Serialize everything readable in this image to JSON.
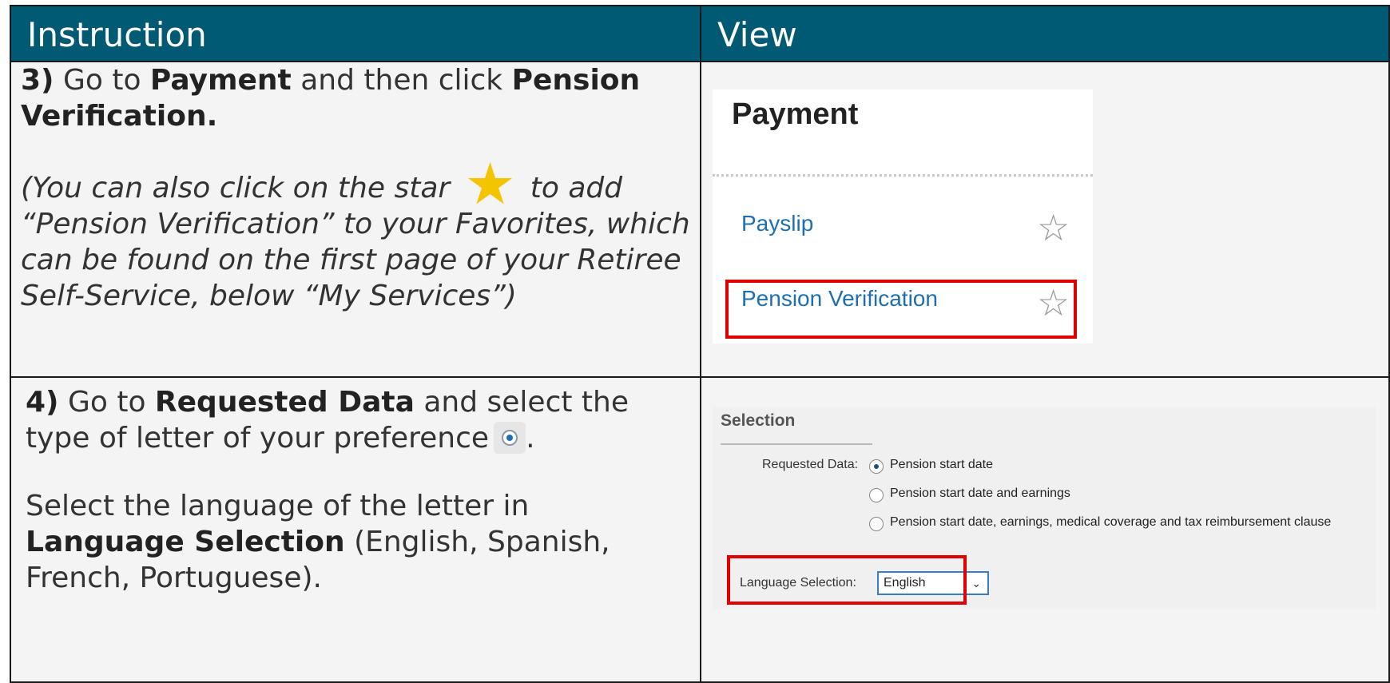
{
  "header": {
    "col1": "Instruction",
    "col2": "View"
  },
  "step3": {
    "num": "3)",
    "t1": " Go to ",
    "payment": "Payment",
    "t2": " and then click ",
    "pension_verification": "Pension Verification.",
    "note_before_star": "(You can also click on the star",
    "note_after_star": "to add “Pension Verification” to your Favorites, which can be found on the first page of your Retiree Self-Service, below “My Services”)"
  },
  "payment_view": {
    "title": "Payment",
    "items": [
      {
        "label": "Payslip"
      },
      {
        "label": "Pension Verification"
      }
    ],
    "star_glyph": "☆"
  },
  "step4": {
    "num": "4)",
    "t1": " Go to ",
    "requested_data": "Requested Data",
    "t2": " and select the type of letter of your preference",
    "t3": ".",
    "p2_t1": "Select the language of the letter in ",
    "language_selection": "Language Selection",
    "p2_t2": " (English, Spanish, French, Portuguese)."
  },
  "selection_view": {
    "title": "Selection",
    "requested_label": "Requested Data:",
    "options": [
      {
        "label": "Pension start date",
        "selected": true
      },
      {
        "label": "Pension start date and earnings",
        "selected": false
      },
      {
        "label": "Pension start date, earnings, medical coverage and tax reimbursement clause",
        "selected": false
      }
    ],
    "language_label": "Language Selection:",
    "language_value": "English",
    "chevron": "⌄"
  },
  "colors": {
    "header_bg": "#005a73",
    "star_gold": "#f5c400",
    "link_blue": "#1f6fb0",
    "highlight_red": "#e00000"
  }
}
